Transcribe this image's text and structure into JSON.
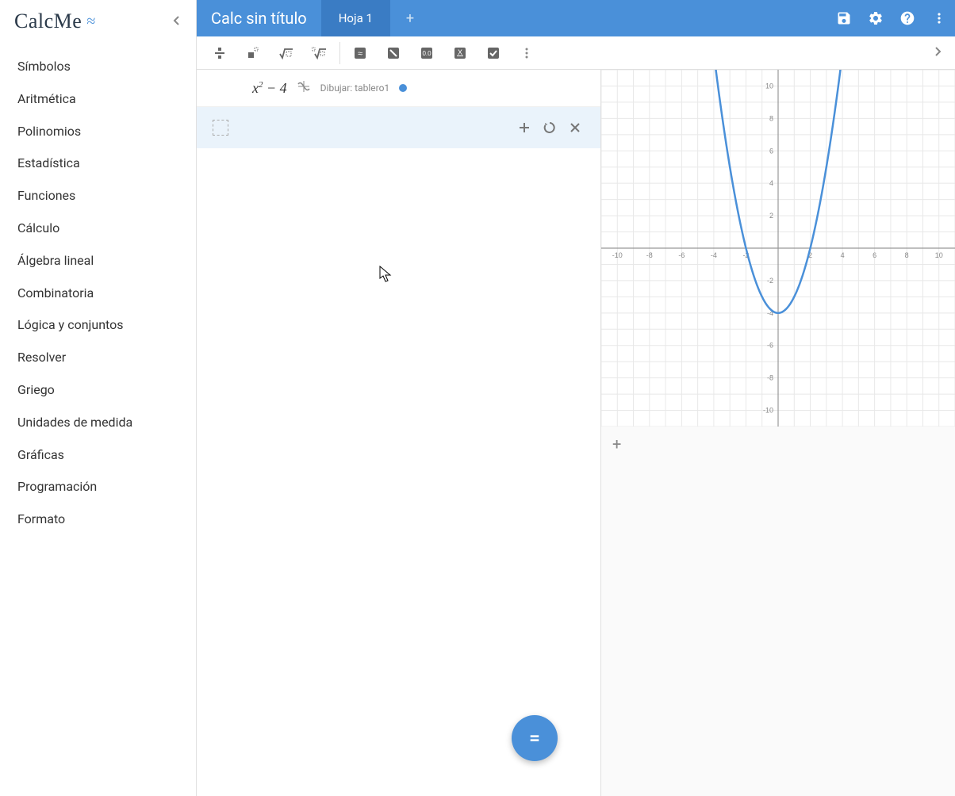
{
  "app": {
    "logo": "CalcMe"
  },
  "sidebar": {
    "items": [
      {
        "label": "Símbolos"
      },
      {
        "label": "Aritmética"
      },
      {
        "label": "Polinomios"
      },
      {
        "label": "Estadística"
      },
      {
        "label": "Funciones"
      },
      {
        "label": "Cálculo"
      },
      {
        "label": "Álgebra lineal"
      },
      {
        "label": "Combinatoria"
      },
      {
        "label": "Lógica y conjuntos"
      },
      {
        "label": "Resolver"
      },
      {
        "label": "Griego"
      },
      {
        "label": "Unidades de medida"
      },
      {
        "label": "Gráficas"
      },
      {
        "label": "Programación"
      },
      {
        "label": "Formato"
      }
    ]
  },
  "titlebar": {
    "doc_title": "Calc sin título",
    "tab_label": "Hoja 1"
  },
  "expression": {
    "formula_html": "x<sup>2</sup> − 4",
    "draw_label": "Dibujar: tablero1",
    "color": "#4a90d9"
  },
  "fab": {
    "label": "="
  },
  "chart_data": {
    "type": "line",
    "title": "",
    "xlabel": "",
    "ylabel": "",
    "xlim": [
      -11,
      11
    ],
    "ylim": [
      -11,
      11
    ],
    "x_ticks": [
      -10,
      -8,
      -6,
      -4,
      -2,
      0,
      2,
      4,
      6,
      8,
      10
    ],
    "y_ticks": [
      -10,
      -8,
      -6,
      -4,
      -2,
      2,
      4,
      6,
      8,
      10
    ],
    "series": [
      {
        "name": "x^2 - 4",
        "color": "#4a90d9",
        "x": [
          -4,
          -3.5,
          -3,
          -2.5,
          -2,
          -1.5,
          -1,
          -0.5,
          0,
          0.5,
          1,
          1.5,
          2,
          2.5,
          3,
          3.5,
          4
        ],
        "y": [
          12,
          8.25,
          5,
          2.25,
          0,
          -1.75,
          -3,
          -3.75,
          -4,
          -3.75,
          -3,
          -1.75,
          0,
          2.25,
          5,
          8.25,
          12
        ]
      }
    ]
  }
}
